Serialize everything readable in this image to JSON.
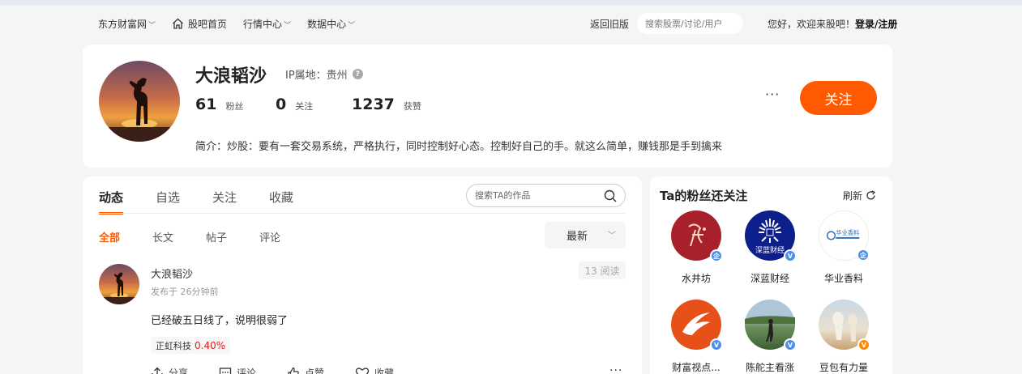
{
  "nav": {
    "items": [
      {
        "label": "东方财富网",
        "has_dropdown": true
      },
      {
        "label": "股吧首页",
        "has_icon": true
      },
      {
        "label": "行情中心",
        "has_dropdown": true
      },
      {
        "label": "数据中心",
        "has_dropdown": true
      }
    ],
    "old_version": "返回旧版",
    "search_placeholder": "搜索股票/讨论/用户",
    "welcome": "您好，欢迎来股吧！",
    "login": "登录/注册"
  },
  "profile": {
    "username": "大浪韬沙",
    "ip_location": "IP属地：贵州",
    "fans_count": "61",
    "fans_label": "粉丝",
    "following_count": "0",
    "following_label": "关注",
    "likes_count": "1237",
    "likes_label": "获赞",
    "bio": "简介：炒股：要有一套交易系统，严格执行，同时控制好心态。控制好自己的手。就这么简单，赚钱那是手到擒来",
    "more": "···",
    "follow_button": "关注"
  },
  "feed": {
    "tabs": [
      "动态",
      "自选",
      "关注",
      "收藏"
    ],
    "active_tab": "动态",
    "search_placeholder": "搜索TA的作品",
    "subtabs": [
      "全部",
      "长文",
      "帖子",
      "评论"
    ],
    "active_subtab": "全部",
    "sort": "最新",
    "post": {
      "author": "大浪韬沙",
      "time": "发布于 26分钟前",
      "reads": "13 阅读",
      "text": "已经破五日线了，说明很弱了",
      "stock_name": "正虹科技",
      "stock_change": "0.40%",
      "actions": [
        "分享",
        "评论",
        "点赞",
        "收藏"
      ],
      "more": "···"
    }
  },
  "sidebar": {
    "title": "Ta的粉丝还关注",
    "refresh": "刷新",
    "fans": [
      {
        "name": "水井坊",
        "badge": "enterprise",
        "avatar_text": "水井坊",
        "color": "#a8202a"
      },
      {
        "name": "深蓝财经",
        "badge": "verified",
        "avatar_text": "深蓝财经",
        "color": "#0d1f8a"
      },
      {
        "name": "华业香料",
        "badge": "enterprise",
        "avatar_text": "华业香料",
        "color": "#ffffff"
      },
      {
        "name": "财富视点...",
        "badge": "verified",
        "avatar_text": "",
        "color": "#e8501a"
      },
      {
        "name": "陈舵主看涨",
        "badge": "verified",
        "avatar_text": "",
        "color": "#5b7a58"
      },
      {
        "name": "豆包有力量",
        "badge": "orange",
        "avatar_text": "",
        "color": "#c9d8e6"
      }
    ]
  },
  "colors": {
    "accent": "#ff5a00",
    "stock_up": "#e02020",
    "verified_badge": "#4a8ef0",
    "orange_badge": "#ff8a00"
  }
}
